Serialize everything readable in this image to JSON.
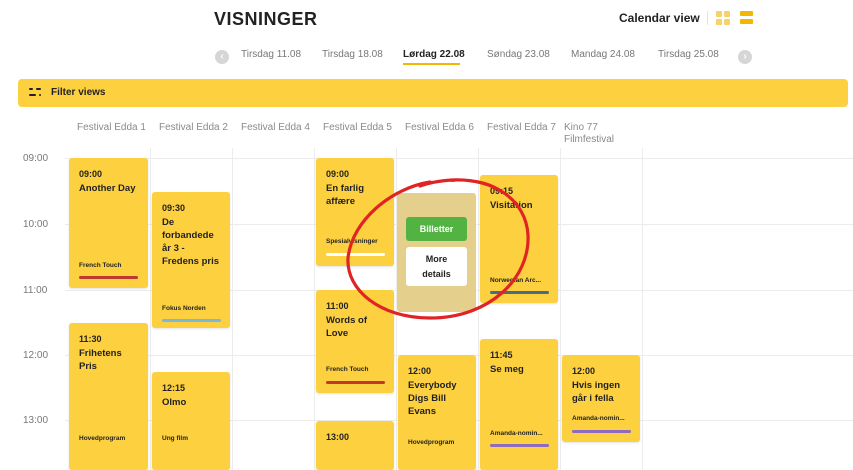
{
  "header": {
    "title": "VISNINGER",
    "view_label": "Calendar view",
    "view_icons": [
      "grid-view-icon",
      "list-view-icon"
    ]
  },
  "day_nav": {
    "prev_icon": "‹",
    "next_icon": "›",
    "days": [
      "Tirsdag 11.08",
      "Tirsdag 18.08",
      "Lørdag 22.08",
      "Søndag 23.08",
      "Mandag 24.08",
      "Tirsdag 25.08"
    ],
    "active": "Lørdag 22.08"
  },
  "filter": {
    "label": "Filter views",
    "icon": "filter-sliders-icon"
  },
  "venues": [
    "Festival Edda 1",
    "Festival Edda 2",
    "Festival Edda 4",
    "Festival Edda 5",
    "Festival Edda 6",
    "Festival Edda 7",
    "Kino 77 Filmfestival"
  ],
  "times": [
    "09:00",
    "10:00",
    "11:00",
    "12:00",
    "13:00"
  ],
  "events": [
    {
      "time": "09:00",
      "title": "Another Day",
      "tag": "French Touch",
      "tag_color": "#c0392b"
    },
    {
      "time": "09:30",
      "title": "De forbandede år 3 - Fredens pris",
      "tag": "Fokus Norden",
      "tag_color": "#7ab8e0"
    },
    {
      "time": "09:00",
      "title": "En farlig affære",
      "tag": "Spesialvisninger",
      "tag_color": "#ffffff"
    },
    {
      "time": "09:15",
      "title": "Visitation",
      "tag": "Norwegian Arc...",
      "tag_color": "#4b6a8a"
    },
    {
      "time": "11:30",
      "title": "Frihetens Pris",
      "tag": "Hovedprogram"
    },
    {
      "time": "12:15",
      "title": "Olmo",
      "tag": "Ung film"
    },
    {
      "time": "11:00",
      "title": "Words of Love",
      "tag": "French Touch",
      "tag_color": "#c0392b"
    },
    {
      "time": "13:00",
      "title": ""
    },
    {
      "time": "12:00",
      "title": "Everybody Digs Bill Evans",
      "tag": "Hovedprogram"
    },
    {
      "time": "11:45",
      "title": "Se meg",
      "tag": "Amanda-nomin...",
      "tag_color": "#8e6bbf"
    },
    {
      "time": "12:00",
      "title": "Hvis ingen går i fella",
      "tag": "Amanda-nomin...",
      "tag_color": "#8e6bbf"
    }
  ],
  "hover_card": {
    "tickets_label": "Billetter",
    "more_label_1": "More",
    "more_label_2": "details"
  },
  "colors": {
    "accent": "#fdd040",
    "tickets": "#52b342",
    "annotation": "#e02424"
  }
}
